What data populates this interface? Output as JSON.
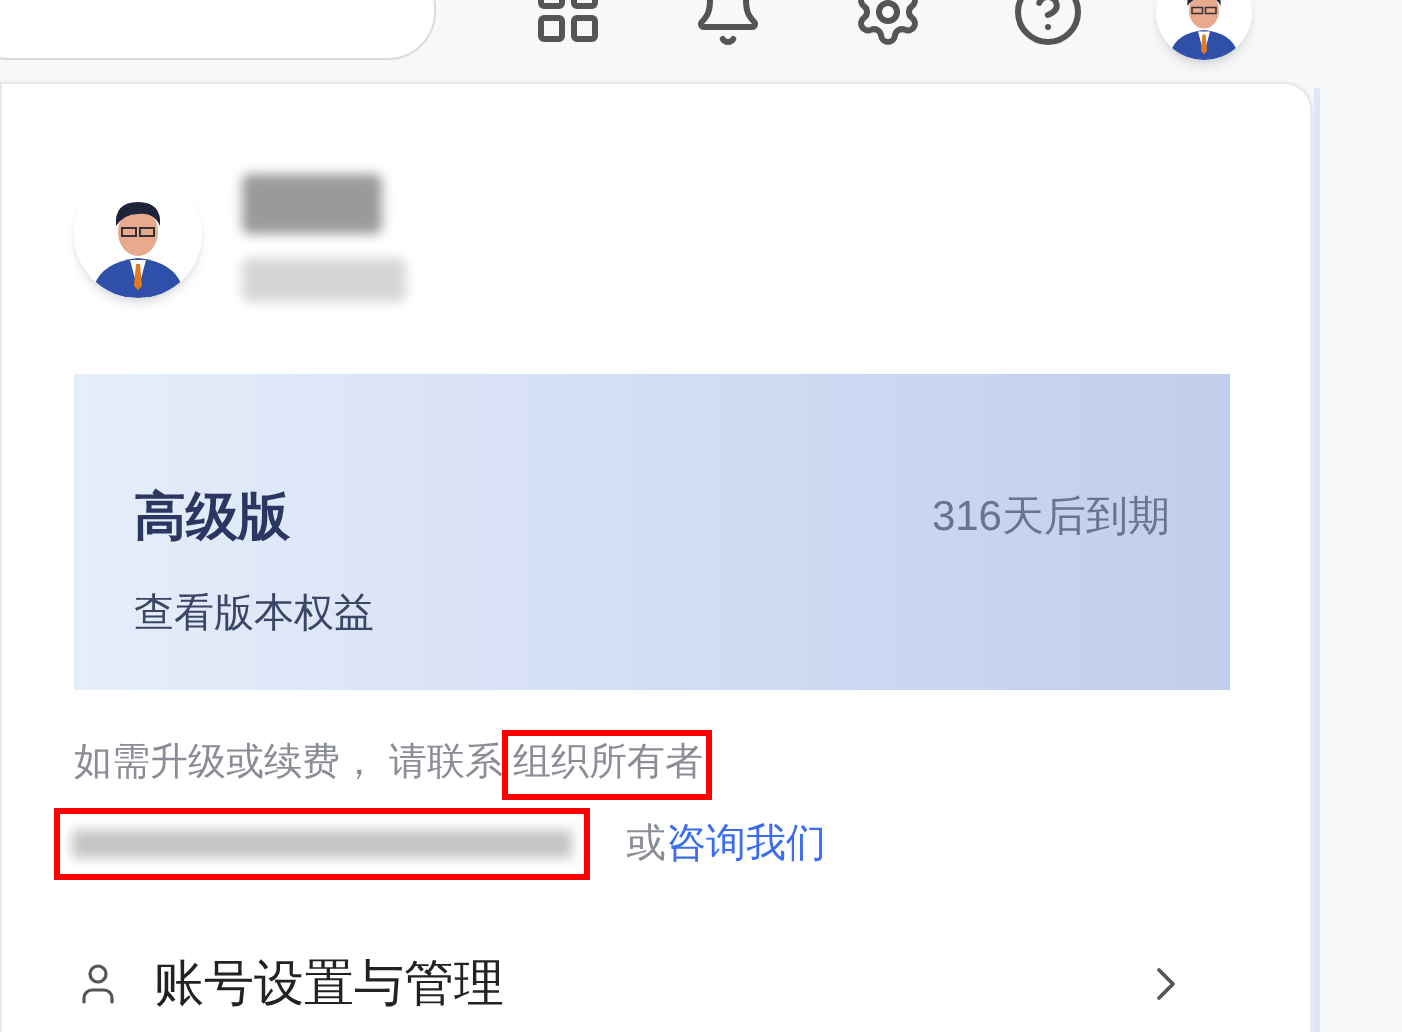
{
  "plan": {
    "name": "高级版",
    "expiry": "316天后到期",
    "link": "查看版本权益"
  },
  "notice": {
    "text": "如需升级或续费， 请联系",
    "highlight": "组织所有者",
    "or": "或",
    "link": "咨询我们"
  },
  "menu": [
    {
      "label": "账号设置与管理"
    }
  ]
}
